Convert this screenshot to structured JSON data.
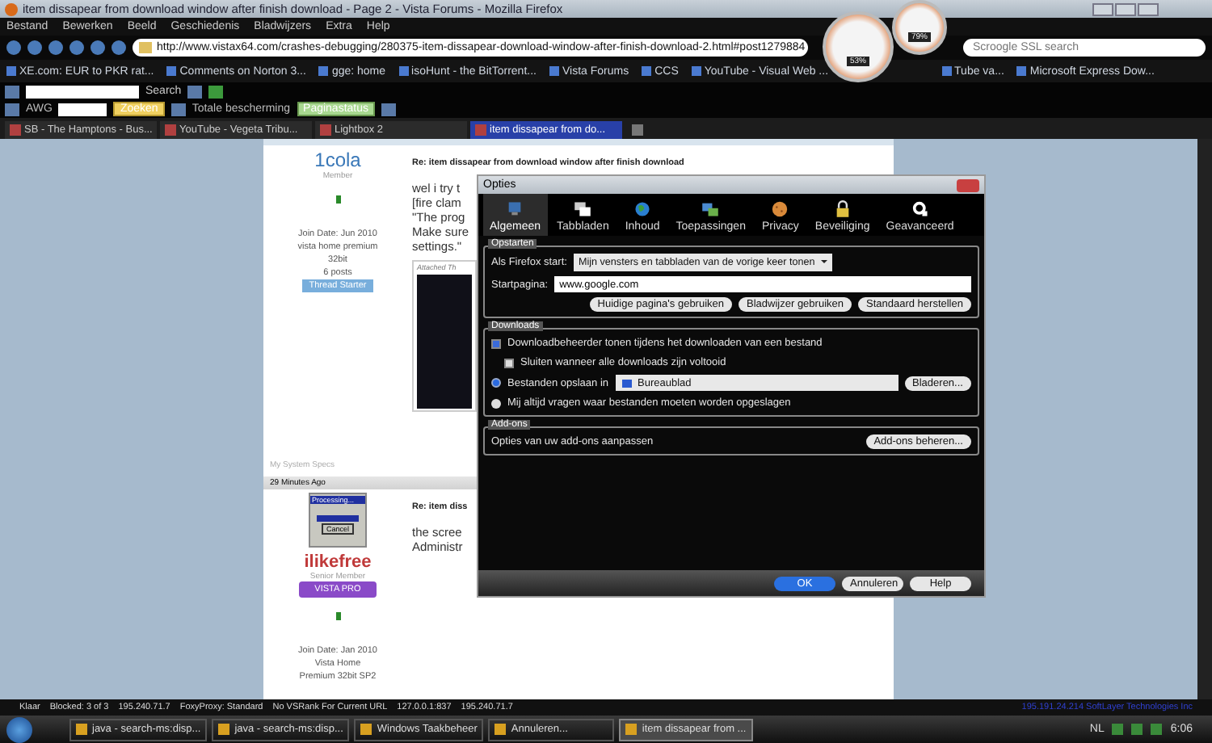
{
  "window": {
    "title": "item dissapear from download window after finish download - Page 2 - Vista Forums - Mozilla Firefox"
  },
  "menu": [
    "Bestand",
    "Bewerken",
    "Beeld",
    "Geschiedenis",
    "Bladwijzers",
    "Extra",
    "Help"
  ],
  "address_bar": {
    "value": "http://www.vistax64.com/crashes-debugging/280375-item-dissapear-download-window-after-finish-download-2.html#post1279884"
  },
  "search": {
    "placeholder": "Scroogle SSL search"
  },
  "bookmarks": [
    "XE.com: EUR to PKR rat...",
    "Comments on Norton 3...",
    "gge: home",
    "isoHunt - the BitTorrent...",
    "Vista Forums",
    "CCS",
    "YouTube - Visual Web ...",
    "Tube va...",
    "Microsoft Express Dow..."
  ],
  "toolbar": {
    "search_label": "Search",
    "awg_label": "AWG",
    "find_button": "Zoeken",
    "protection_label": "Totale bescherming",
    "page_status": "Paginastatus"
  },
  "tabs": [
    {
      "label": "SB - The Hamptons - Bus...",
      "selected": false
    },
    {
      "label": "YouTube - Vegeta Tribu...",
      "selected": false
    },
    {
      "label": "Lightbox 2",
      "selected": false
    },
    {
      "label": "item dissapear from do...",
      "selected": true
    }
  ],
  "gauges": [
    {
      "reading": "53%"
    },
    {
      "reading": "79%"
    }
  ],
  "posts": [
    {
      "user": "1cola",
      "rank": "Member",
      "details": [
        "Join Date: Jun 2010",
        "vista home premium",
        "32bit",
        "6 posts"
      ],
      "badge": "Thread Starter",
      "title": "Re: item dissapear from download window after finish download",
      "body": [
        "wel i try t",
        "[fire clam",
        "\"The prog",
        "Make sure",
        "settings.\""
      ],
      "attachment_label": "Attached Th",
      "specs_link": "My System Specs"
    },
    {
      "time": "29 Minutes Ago",
      "user": "ilikefree",
      "rank": "Senior Member",
      "badge": "VISTA PRO",
      "avatar_title": "Processing...",
      "avatar_button": "Cancel",
      "details": [
        "Join Date: Jan 2010",
        "Vista Home",
        "Premium 32bit SP2"
      ],
      "title": "Re: item diss",
      "body": [
        "the scree",
        "Administr"
      ]
    }
  ],
  "dialog": {
    "title": "Opties",
    "tabs": [
      {
        "label": "Algemeen",
        "kind": "monitor",
        "selected": true
      },
      {
        "label": "Tabbladen",
        "kind": "windows",
        "selected": false
      },
      {
        "label": "Inhoud",
        "kind": "globe",
        "selected": false
      },
      {
        "label": "Toepassingen",
        "kind": "screens",
        "selected": false
      },
      {
        "label": "Privacy",
        "kind": "cookie",
        "selected": false
      },
      {
        "label": "Beveiliging",
        "kind": "padlock",
        "selected": false
      },
      {
        "label": "Geavanceerd",
        "kind": "gear",
        "selected": false
      }
    ],
    "startup": {
      "legend": "Opstarten",
      "start_label": "Als Firefox start:",
      "start_value": "Mijn vensters en tabbladen van de vorige keer tonen",
      "homepage_label": "Startpagina:",
      "homepage_value": "www.google.com",
      "buttons": [
        "Huidige pagina's gebruiken",
        "Bladwijzer gebruiken",
        "Standaard herstellen"
      ]
    },
    "downloads": {
      "legend": "Downloads",
      "show_manager": {
        "label": "Downloadbeheerder tonen tijdens het downloaden van een bestand",
        "checked": true
      },
      "close_when_done": {
        "label": "Sluiten wanneer alle downloads zijn voltooid",
        "checked": false
      },
      "save_options": [
        {
          "label": "Bestanden opslaan in",
          "selected": true
        },
        {
          "label": "Mij altijd vragen waar bestanden moeten worden opgeslagen",
          "selected": false
        }
      ],
      "folder": "Bureaublad",
      "browse_button": "Bladeren..."
    },
    "addons": {
      "legend": "Add-ons",
      "text": "Opties van uw add-ons aanpassen",
      "button": "Add-ons beheren..."
    },
    "buttons": [
      {
        "label": "OK",
        "kind": "default"
      },
      {
        "label": "Annuleren",
        "kind": "normal"
      },
      {
        "label": "Help",
        "kind": "normal"
      }
    ]
  },
  "status_bar": [
    "Klaar",
    "Blocked: 3 of 3",
    "195.240.71.7",
    "FoxyProxy: Standard",
    "No VSRank For Current URL",
    "127.0.0.1:837",
    "195.240.71.7",
    "195.191.24.214 SoftLayer Technologies Inc"
  ],
  "taskbar": {
    "items": [
      {
        "label": "java - search-ms:disp...",
        "selected": false
      },
      {
        "label": "java - search-ms:disp...",
        "selected": false
      },
      {
        "label": "Windows Taakbeheer",
        "selected": false
      },
      {
        "label": "Annuleren...",
        "selected": false
      },
      {
        "label": "item dissapear from ...",
        "selected": true
      }
    ],
    "language": "NL",
    "clock": "6:06"
  }
}
